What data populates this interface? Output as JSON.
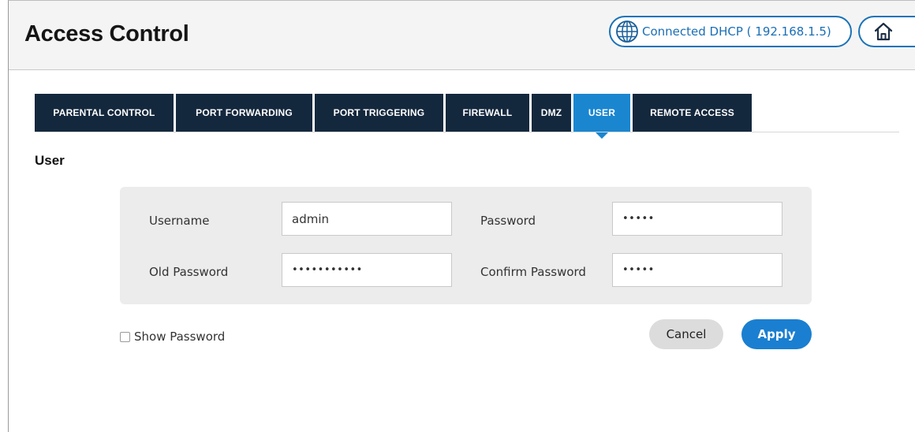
{
  "header": {
    "title": "Access Control",
    "connection_status": "Connected DHCP  ( 192.168.1.5)",
    "icons": {
      "status": "globe-icon",
      "home": "home-icon"
    }
  },
  "tabs": [
    {
      "label": "PARENTAL CONTROL",
      "active": false
    },
    {
      "label": "PORT FORWARDING",
      "active": false
    },
    {
      "label": "PORT TRIGGERING",
      "active": false
    },
    {
      "label": "FIREWALL",
      "active": false
    },
    {
      "label": "DMZ",
      "active": false
    },
    {
      "label": "USER",
      "active": true
    },
    {
      "label": "REMOTE ACCESS",
      "active": false
    }
  ],
  "section": {
    "title": "User"
  },
  "form": {
    "username_label": "Username",
    "username_value": "admin",
    "password_label": "Password",
    "password_value": "•••••",
    "old_password_label": "Old Password",
    "old_password_value": "•••••••••••",
    "confirm_password_label": "Confirm Password",
    "confirm_password_value": "•••••"
  },
  "show_password": {
    "label": "Show Password",
    "checked": false
  },
  "actions": {
    "cancel_label": "Cancel",
    "apply_label": "Apply"
  },
  "colors": {
    "accent": "#1a86d0",
    "tab_dark": "#14283d",
    "apply": "#1a7fd0"
  }
}
